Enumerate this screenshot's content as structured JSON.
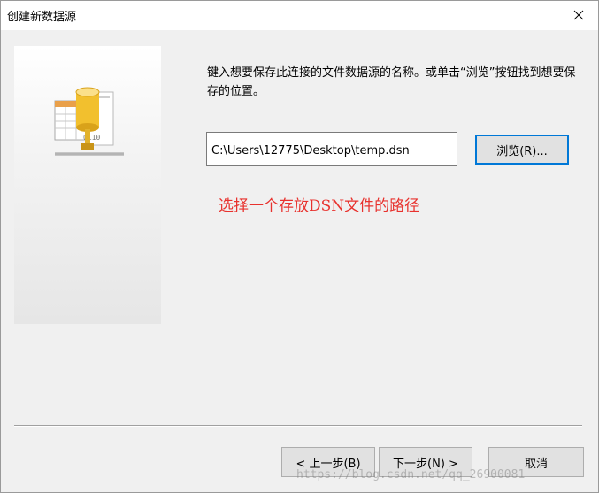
{
  "window": {
    "title": "创建新数据源",
    "close_icon": "close-icon"
  },
  "side_panel": {
    "icon": "data-source-icon"
  },
  "instruction": "键入想要保存此连接的文件数据源的名称。或单击“浏览”按钮找到想要保存的位置。",
  "path_field": {
    "value": "C:\\Users\\12775\\Desktop\\temp.dsn"
  },
  "buttons": {
    "browse": "浏览(R)...",
    "back": "< 上一步(B)",
    "next": "下一步(N) >",
    "cancel": "取消"
  },
  "annotation": {
    "text": "选择一个存放DSN文件的路径",
    "color": "#e8322e"
  },
  "watermark": "https://blog.csdn.net/qq_26900081",
  "colors": {
    "focus_border": "#0078d7",
    "dialog_bg": "#f0f0f0"
  }
}
